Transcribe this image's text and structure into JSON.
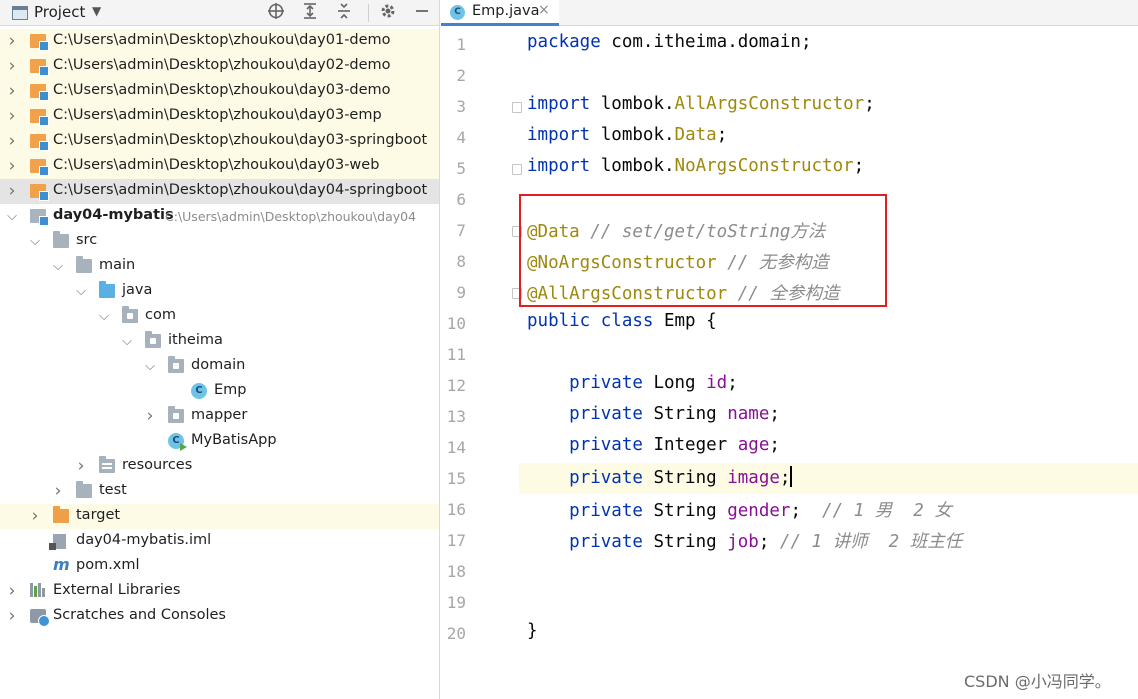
{
  "project_panel": {
    "title": "Project",
    "tree": [
      {
        "label": "C:\\Users\\admin\\Desktop\\zhoukou\\day01-demo",
        "depth": 0,
        "expand": "collapsed",
        "icon": "module-icon",
        "style": "hl"
      },
      {
        "label": "C:\\Users\\admin\\Desktop\\zhoukou\\day02-demo",
        "depth": 0,
        "expand": "collapsed",
        "icon": "module-icon",
        "style": "hl"
      },
      {
        "label": "C:\\Users\\admin\\Desktop\\zhoukou\\day03-demo",
        "depth": 0,
        "expand": "collapsed",
        "icon": "module-icon",
        "style": "hl"
      },
      {
        "label": "C:\\Users\\admin\\Desktop\\zhoukou\\day03-emp",
        "depth": 0,
        "expand": "collapsed",
        "icon": "module-icon",
        "style": "hl"
      },
      {
        "label": "C:\\Users\\admin\\Desktop\\zhoukou\\day03-springboot",
        "depth": 0,
        "expand": "collapsed",
        "icon": "module-icon",
        "style": "hl"
      },
      {
        "label": "C:\\Users\\admin\\Desktop\\zhoukou\\day03-web",
        "depth": 0,
        "expand": "collapsed",
        "icon": "module-icon",
        "style": "hl"
      },
      {
        "label": "C:\\Users\\admin\\Desktop\\zhoukou\\day04-springboot",
        "depth": 0,
        "expand": "collapsed",
        "icon": "module-icon",
        "style": "sel"
      },
      {
        "label": "day04-mybatis",
        "hint": "C:\\Users\\admin\\Desktop\\zhoukou\\day04",
        "depth": 0,
        "expand": "expanded",
        "icon": "module-gray-icon",
        "style": "",
        "bold": true
      },
      {
        "label": "src",
        "depth": 1,
        "expand": "expanded",
        "icon": "folder-icon",
        "style": ""
      },
      {
        "label": "main",
        "depth": 2,
        "expand": "expanded",
        "icon": "folder-icon",
        "style": ""
      },
      {
        "label": "java",
        "depth": 3,
        "expand": "expanded",
        "icon": "source-folder-icon",
        "style": ""
      },
      {
        "label": "com",
        "depth": 4,
        "expand": "expanded",
        "icon": "package-icon",
        "style": ""
      },
      {
        "label": "itheima",
        "depth": 5,
        "expand": "expanded",
        "icon": "package-icon",
        "style": ""
      },
      {
        "label": "domain",
        "depth": 6,
        "expand": "expanded",
        "icon": "package-icon",
        "style": ""
      },
      {
        "label": "Emp",
        "depth": 7,
        "expand": "none",
        "icon": "class-icon",
        "style": ""
      },
      {
        "label": "mapper",
        "depth": 6,
        "expand": "collapsed",
        "icon": "package-icon",
        "style": ""
      },
      {
        "label": "MyBatisApp",
        "depth": 6,
        "expand": "none",
        "icon": "run-class-icon",
        "style": ""
      },
      {
        "label": "resources",
        "depth": 3,
        "expand": "collapsed",
        "icon": "resources-folder-icon",
        "style": ""
      },
      {
        "label": "test",
        "depth": 2,
        "expand": "collapsed",
        "icon": "folder-icon",
        "style": ""
      },
      {
        "label": "target",
        "depth": 1,
        "expand": "collapsed",
        "icon": "excluded-folder-icon",
        "style": "hl"
      },
      {
        "label": "day04-mybatis.iml",
        "depth": 1,
        "expand": "none",
        "icon": "iml-file-icon",
        "style": ""
      },
      {
        "label": "pom.xml",
        "depth": 1,
        "expand": "none",
        "icon": "maven-icon",
        "style": ""
      },
      {
        "label": "External Libraries",
        "depth": 0,
        "expand": "collapsed",
        "icon": "libraries-icon",
        "style": ""
      },
      {
        "label": "Scratches and Consoles",
        "depth": 0,
        "expand": "collapsed",
        "icon": "scratches-icon",
        "style": ""
      }
    ]
  },
  "editor": {
    "tab": {
      "label": "Emp.java",
      "icon_letter": "C",
      "close": "×"
    },
    "current_line": 15,
    "lines": [
      {
        "n": "1",
        "parts": [
          [
            "kw",
            "package "
          ],
          [
            "",
            "com.itheima.domain;"
          ]
        ]
      },
      {
        "n": "2",
        "parts": []
      },
      {
        "n": "3",
        "fold": true,
        "parts": [
          [
            "kw",
            "import "
          ],
          [
            "",
            "lombok."
          ],
          [
            "pkgc",
            "AllArgsConstructor"
          ],
          [
            "",
            ";"
          ]
        ]
      },
      {
        "n": "4",
        "parts": [
          [
            "kw",
            "import "
          ],
          [
            "",
            "lombok."
          ],
          [
            "pkgc",
            "Data"
          ],
          [
            "",
            ";"
          ]
        ]
      },
      {
        "n": "5",
        "fold": true,
        "parts": [
          [
            "kw",
            "import "
          ],
          [
            "",
            "lombok."
          ],
          [
            "pkgc",
            "NoArgsConstructor"
          ],
          [
            "",
            ";"
          ]
        ]
      },
      {
        "n": "6",
        "parts": []
      },
      {
        "n": "7",
        "fold": true,
        "parts": [
          [
            "ann",
            "@Data"
          ],
          [
            "",
            " "
          ],
          [
            "cmt",
            "// set/get/toString方法"
          ]
        ]
      },
      {
        "n": "8",
        "parts": [
          [
            "ann",
            "@NoArgsConstructor"
          ],
          [
            "",
            " "
          ],
          [
            "cmt",
            "// 无参构造"
          ]
        ]
      },
      {
        "n": "9",
        "fold": true,
        "parts": [
          [
            "ann",
            "@AllArgsConstructor"
          ],
          [
            "",
            " "
          ],
          [
            "cmt",
            "// 全参构造"
          ]
        ]
      },
      {
        "n": "10",
        "parts": [
          [
            "kw",
            "public class "
          ],
          [
            "",
            "Emp {"
          ]
        ]
      },
      {
        "n": "11",
        "parts": []
      },
      {
        "n": "12",
        "parts": [
          [
            "",
            "    "
          ],
          [
            "kw",
            "private "
          ],
          [
            "",
            "Long "
          ],
          [
            "field",
            "id"
          ],
          [
            "",
            ";"
          ]
        ]
      },
      {
        "n": "13",
        "parts": [
          [
            "",
            "    "
          ],
          [
            "kw",
            "private "
          ],
          [
            "",
            "String "
          ],
          [
            "field",
            "name"
          ],
          [
            "",
            ";"
          ]
        ]
      },
      {
        "n": "14",
        "parts": [
          [
            "",
            "    "
          ],
          [
            "kw",
            "private "
          ],
          [
            "",
            "Integer "
          ],
          [
            "field",
            "age"
          ],
          [
            "",
            ";"
          ]
        ]
      },
      {
        "n": "15",
        "parts": [
          [
            "",
            "    "
          ],
          [
            "kw",
            "private "
          ],
          [
            "",
            "String "
          ],
          [
            "field",
            "image"
          ],
          [
            "",
            ";"
          ]
        ],
        "caret": true
      },
      {
        "n": "16",
        "parts": [
          [
            "",
            "    "
          ],
          [
            "kw",
            "private "
          ],
          [
            "",
            "String "
          ],
          [
            "field",
            "gender"
          ],
          [
            "",
            ";  "
          ],
          [
            "cmt",
            "// 1 男  2 女"
          ]
        ]
      },
      {
        "n": "17",
        "parts": [
          [
            "",
            "    "
          ],
          [
            "kw",
            "private "
          ],
          [
            "",
            "String "
          ],
          [
            "field",
            "job"
          ],
          [
            "",
            "; "
          ],
          [
            "cmt",
            "// 1 讲师  2 班主任"
          ]
        ]
      },
      {
        "n": "18",
        "parts": []
      },
      {
        "n": "19",
        "parts": []
      },
      {
        "n": "20",
        "parts": [
          [
            "",
            "}"
          ]
        ]
      }
    ]
  },
  "watermark": "CSDN @小冯同学。"
}
